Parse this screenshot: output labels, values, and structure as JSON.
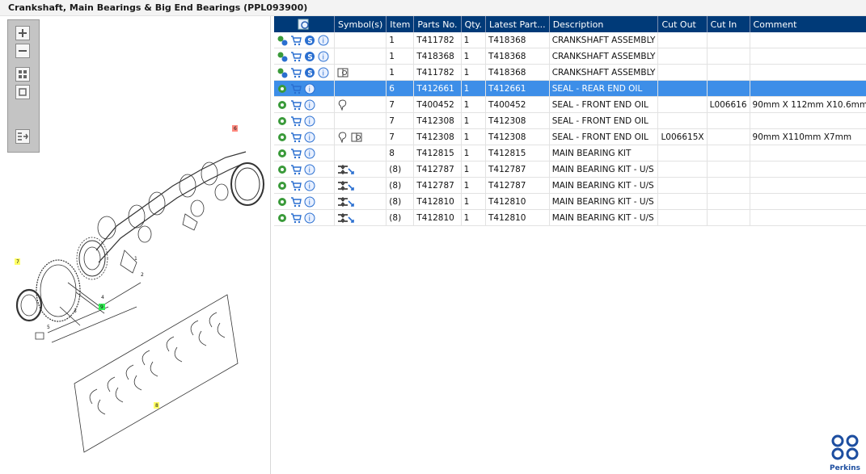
{
  "title": "Crankshaft, Main Bearings & Big End Bearings (PPL093900)",
  "diagram": {
    "callouts": [
      "6",
      "7",
      "8",
      "9",
      "1",
      "2",
      "3",
      "4",
      "5"
    ]
  },
  "toolbar": {
    "icons": [
      "zoom-in-icon",
      "zoom-out-icon",
      "grid-view-icon",
      "fit-view-icon",
      "list-export-icon"
    ]
  },
  "table": {
    "columns": [
      "",
      "Symbol(s)",
      "Item",
      "Parts No.",
      "Qty.",
      "Latest Part...",
      "Description",
      "Cut Out",
      "Cut In",
      "Comment"
    ],
    "rows": [
      {
        "icons": "gear-cart-s-info",
        "symbol": "",
        "item": "1",
        "parts_no": "T411782",
        "qty": "1",
        "latest": "T418368",
        "description": "CRANKSHAFT ASSEMBLY",
        "cut_out": "",
        "cut_in": "",
        "comment": ""
      },
      {
        "icons": "gear-cart-s-info",
        "symbol": "",
        "item": "1",
        "parts_no": "T418368",
        "qty": "1",
        "latest": "T418368",
        "description": "CRANKSHAFT ASSEMBLY",
        "cut_out": "",
        "cut_in": "",
        "comment": ""
      },
      {
        "icons": "gear-cart-s-info",
        "symbol": "book",
        "item": "1",
        "parts_no": "T411782",
        "qty": "1",
        "latest": "T418368",
        "description": "CRANKSHAFT ASSEMBLY",
        "cut_out": "",
        "cut_in": "",
        "comment": ""
      },
      {
        "icons": "gear-cart-info",
        "symbol": "",
        "item": "6",
        "parts_no": "T412661",
        "qty": "1",
        "latest": "T412661",
        "description": "SEAL - REAR END OIL",
        "cut_out": "",
        "cut_in": "",
        "comment": "",
        "selected": true
      },
      {
        "icons": "gear-cart-info",
        "symbol": "balloon",
        "item": "7",
        "parts_no": "T400452",
        "qty": "1",
        "latest": "T400452",
        "description": "SEAL - FRONT END OIL",
        "cut_out": "",
        "cut_in": "L006616",
        "comment": "90mm X 112mm X10.6mm"
      },
      {
        "icons": "gear-cart-info",
        "symbol": "",
        "item": "7",
        "parts_no": "T412308",
        "qty": "1",
        "latest": "T412308",
        "description": "SEAL - FRONT END OIL",
        "cut_out": "",
        "cut_in": "",
        "comment": ""
      },
      {
        "icons": "gear-cart-info",
        "symbol": "balloon-book",
        "item": "7",
        "parts_no": "T412308",
        "qty": "1",
        "latest": "T412308",
        "description": "SEAL - FRONT END OIL",
        "cut_out": "L006615X",
        "cut_in": "",
        "comment": "90mm X110mm X7mm"
      },
      {
        "icons": "gear-cart-info",
        "symbol": "",
        "item": "8",
        "parts_no": "T412815",
        "qty": "1",
        "latest": "T412815",
        "description": "MAIN BEARING KIT",
        "cut_out": "",
        "cut_in": "",
        "comment": ""
      },
      {
        "icons": "gear-cart-info",
        "symbol": "undersize",
        "item": "(8)",
        "parts_no": "T412787",
        "qty": "1",
        "latest": "T412787",
        "description": "MAIN BEARING KIT - U/S",
        "cut_out": "",
        "cut_in": "",
        "comment": ""
      },
      {
        "icons": "gear-cart-info",
        "symbol": "undersize",
        "item": "(8)",
        "parts_no": "T412787",
        "qty": "1",
        "latest": "T412787",
        "description": "MAIN BEARING KIT - U/S",
        "cut_out": "",
        "cut_in": "",
        "comment": ""
      },
      {
        "icons": "gear-cart-info",
        "symbol": "undersize",
        "item": "(8)",
        "parts_no": "T412810",
        "qty": "1",
        "latest": "T412810",
        "description": "MAIN BEARING KIT - U/S",
        "cut_out": "",
        "cut_in": "",
        "comment": ""
      },
      {
        "icons": "gear-cart-info",
        "symbol": "undersize",
        "item": "(8)",
        "parts_no": "T412810",
        "qty": "1",
        "latest": "T412810",
        "description": "MAIN BEARING KIT - U/S",
        "cut_out": "",
        "cut_in": "",
        "comment": ""
      }
    ]
  },
  "brand": {
    "name": "Perkins",
    "color": "#1d4ea0"
  },
  "colors": {
    "header_bg": "#003a78",
    "selected_row": "#3d8ee8"
  }
}
